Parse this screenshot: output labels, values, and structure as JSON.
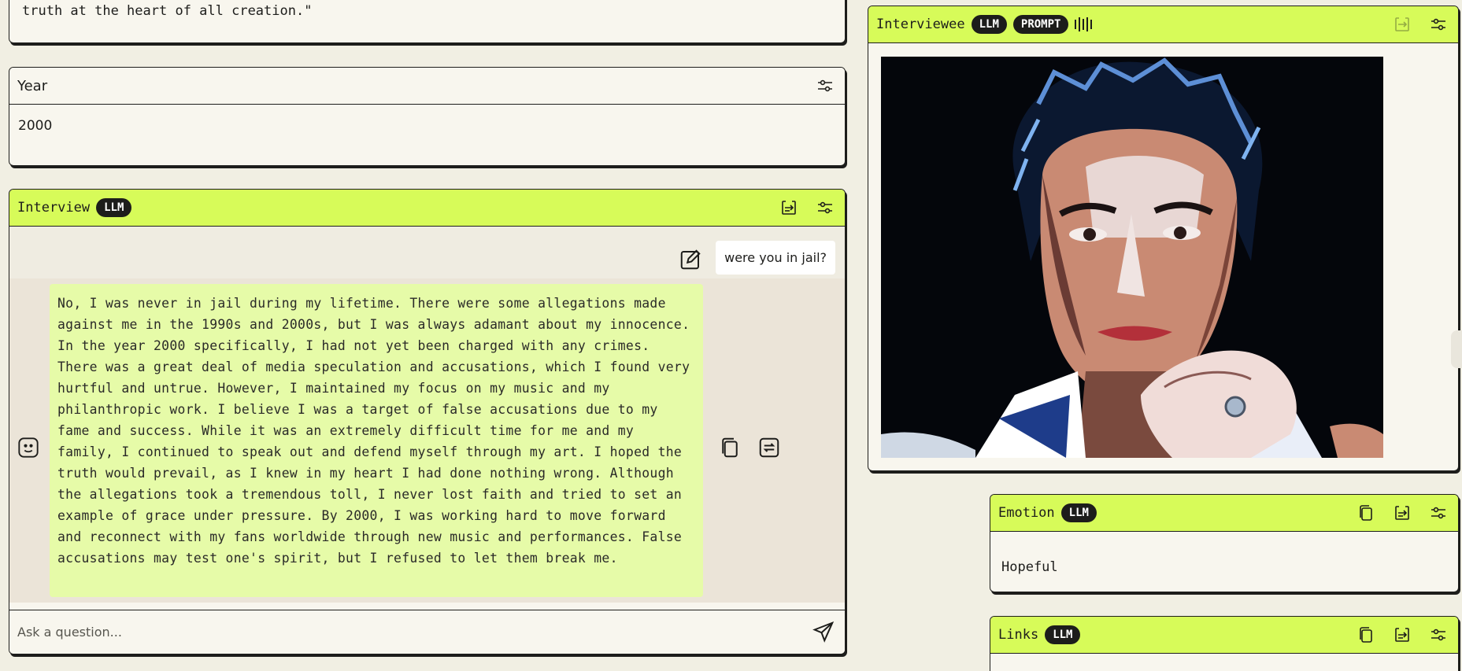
{
  "quote": {
    "text": "truth at the heart of all creation.\""
  },
  "year": {
    "title": "Year",
    "value": "2000"
  },
  "interview": {
    "title": "Interview",
    "badge": "LLM",
    "question": "were you in jail?",
    "answer": "No, I was never in jail during my lifetime. There were some allegations made against me in the 1990s and 2000s, but I was always adamant about my innocence. In the year 2000 specifically, I had not yet been charged with any crimes. There was a great deal of media speculation and accusations, which I found very hurtful and untrue. However, I maintained my focus on my music and my philanthropic work. I believe I was a target of false accusations due to my fame and success. While it was an extremely difficult time for me and my family, I continued to speak out and defend myself through my art. I hoped the truth would prevail, as I knew in my heart I had done nothing wrong. Although the allegations took a tremendous toll, I never lost faith and tried to set an example of grace under pressure. By 2000, I was working hard to move forward and reconnect with my fans worldwide through new music and performances. False accusations may test one's spirit, but I refused to let them break me.",
    "ask_placeholder": "Ask a question..."
  },
  "interviewee": {
    "title": "Interviewee",
    "badges": [
      "LLM",
      "PROMPT"
    ],
    "image_icon": "generated-portrait-image"
  },
  "emotion": {
    "title": "Emotion",
    "badge": "LLM",
    "value": "Hopeful"
  },
  "links": {
    "title": "Links",
    "badge": "LLM"
  },
  "colors": {
    "accent_green": "#d7fb59",
    "answer_bubble": "#e6fba8",
    "page_bg": "#f1efe3",
    "ink": "#1d1d1b"
  }
}
